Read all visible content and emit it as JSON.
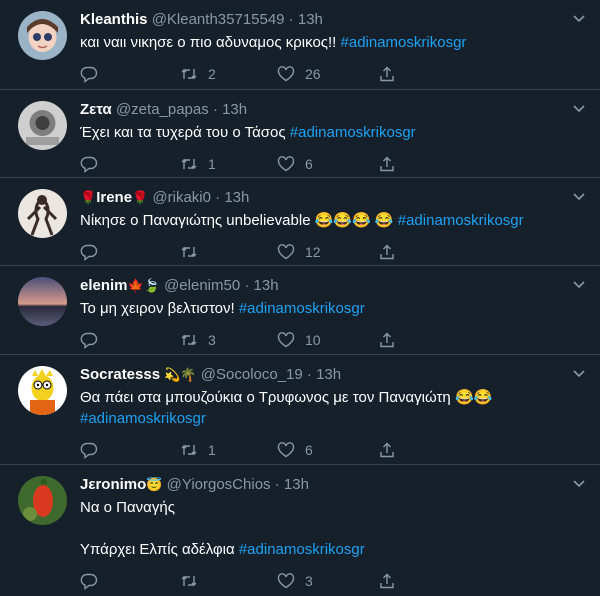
{
  "colors": {
    "background": "#15202b",
    "text": "#ffffff",
    "secondary": "#8899a6",
    "hashtag": "#1da1f2",
    "divider": "#38444d"
  },
  "icons": [
    "reply-icon",
    "retweet-icon",
    "like-icon",
    "share-icon",
    "caret-down-icon"
  ],
  "tweets": [
    {
      "name": "Kleanthis",
      "emoji": "",
      "handle": "@Kleanth35715549",
      "dot": "·",
      "time": "13h",
      "text": "και ναιι νικησε ο πιο αδυναμος κρικος!! ",
      "hashtag": "#adinamoskrikosgr",
      "replies": "",
      "retweets": "2",
      "likes": "26"
    },
    {
      "name": "Ζετα",
      "emoji": "",
      "handle": "@zeta_papas",
      "dot": "·",
      "time": "13h",
      "text": "Έχει και τα τυχερά του ο Τάσος ",
      "hashtag": "#adinamoskrikosgr",
      "replies": "",
      "retweets": "1",
      "likes": "6"
    },
    {
      "name": "Irene",
      "emoji": "🌹",
      "name_prefix": "🌹",
      "handle": "@rikaki0",
      "dot": "·",
      "time": "13h",
      "text": "Νίκησε ο Παναγιώτης unbelievable 😂😂😂 😂 ",
      "hashtag": "#adinamoskrikosgr",
      "replies": "",
      "retweets": "",
      "likes": "12"
    },
    {
      "name": "elenim",
      "emoji": "🍁🍃",
      "handle": "@elenim50",
      "dot": "·",
      "time": "13h",
      "text": "Το μη χειρον βελτιστον! ",
      "hashtag": "#adinamoskrikosgr",
      "replies": "",
      "retweets": "3",
      "likes": "10"
    },
    {
      "name": "Socratesss",
      "emoji": "💫🌴",
      "handle": "@Socoloco_19",
      "dot": "·",
      "time": "13h",
      "text": "Θα πάει στα μπουζούκια ο Τρυφωνος με τον Παναγιώτη 😂😂\n",
      "hashtag": "#adinamoskrikosgr",
      "replies": "",
      "retweets": "1",
      "likes": "6"
    },
    {
      "name": "Jεronimo",
      "emoji": "😇",
      "handle": "@YiorgosChios",
      "dot": "·",
      "time": "13h",
      "text": "Να ο Παναγής\n\nΥπάρχει Ελπίς αδέλφια ",
      "hashtag": "#adinamoskrikosgr",
      "replies": "",
      "retweets": "",
      "likes": "3"
    }
  ]
}
